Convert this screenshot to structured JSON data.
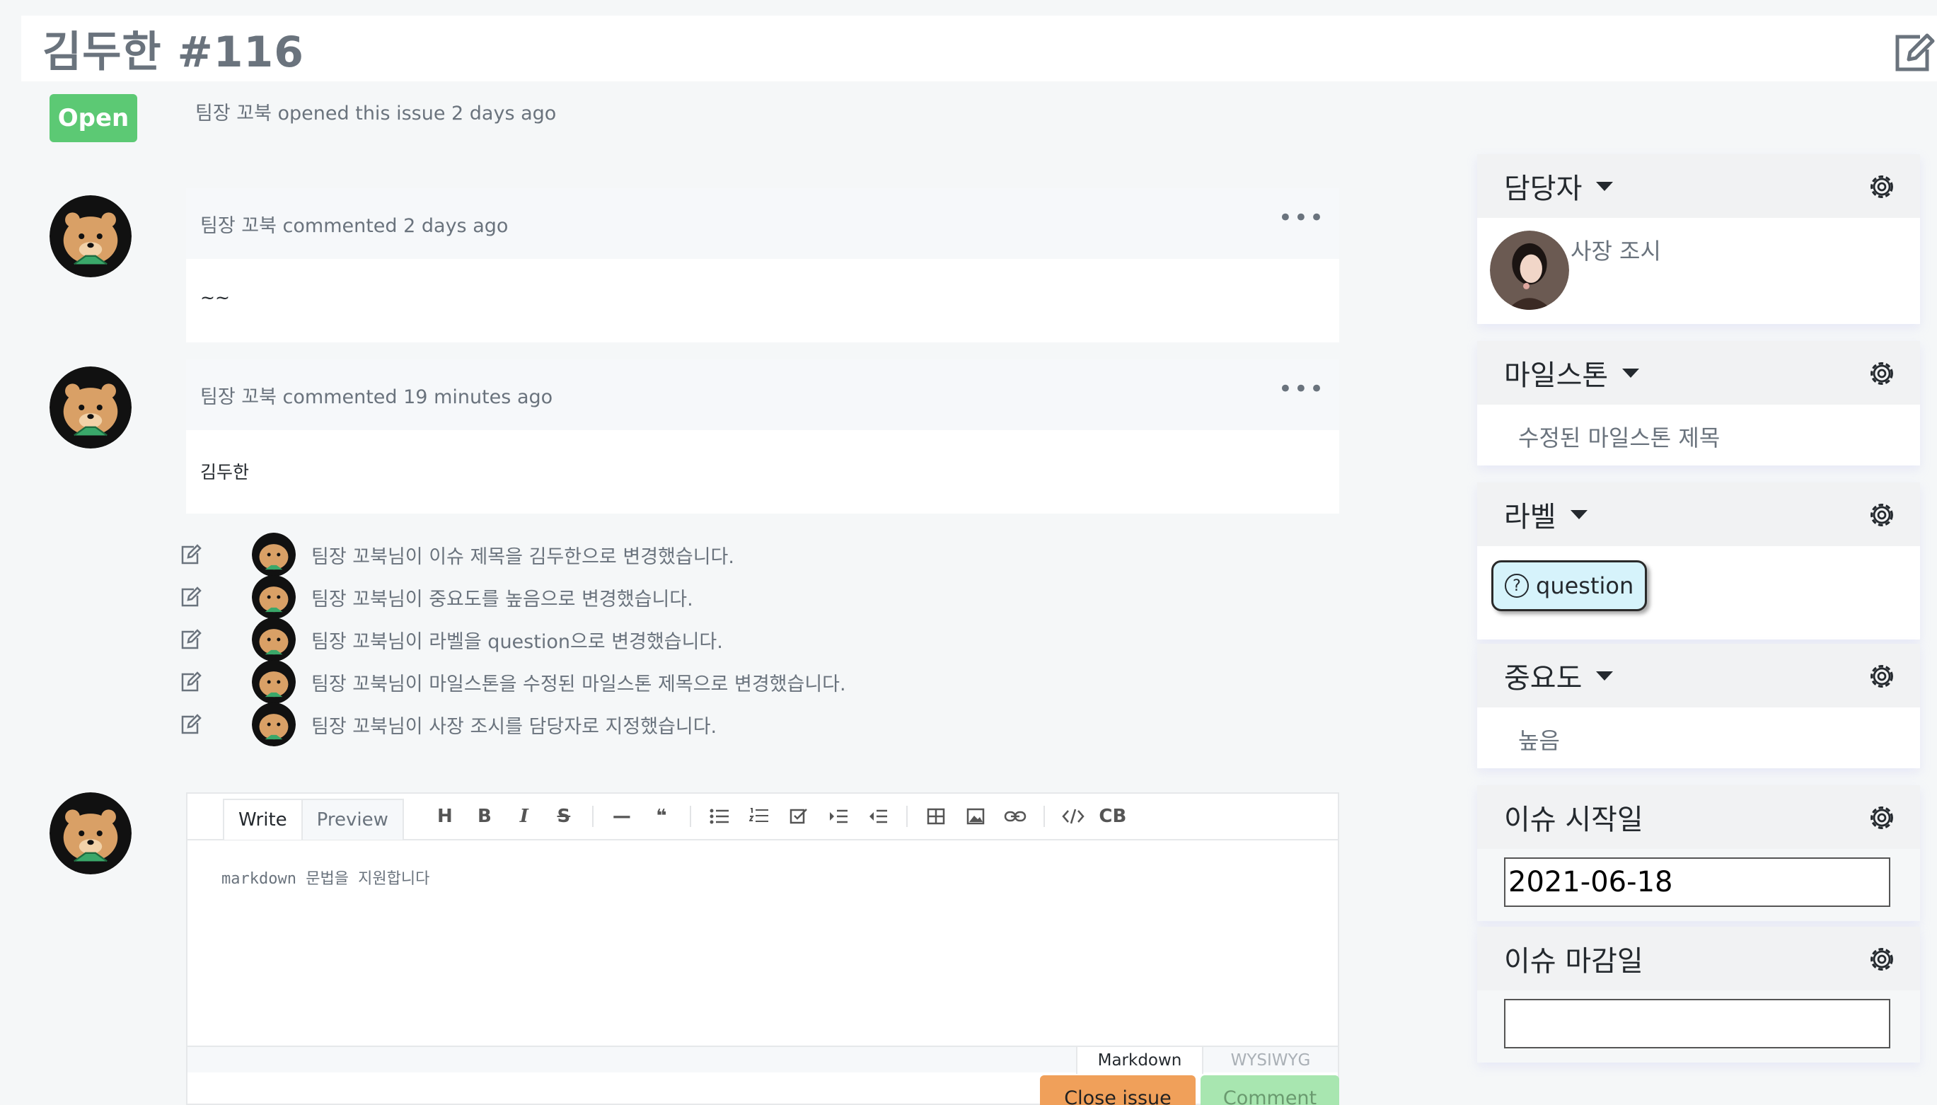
{
  "issue": {
    "title": "김두한 #116",
    "status": "Open",
    "opened_meta": "팀장 꼬북 opened this issue 2 days ago"
  },
  "comments": [
    {
      "meta": "팀장 꼬북 commented 2 days ago",
      "menu": "•••",
      "body": "~~"
    },
    {
      "meta": "팀장 꼬북 commented 19 minutes ago",
      "menu": "•••",
      "body": "김두한"
    }
  ],
  "history": [
    "팀장 꼬북님이 이슈 제목을 김두한으로 변경했습니다.",
    "팀장 꼬북님이 중요도를 높음으로 변경했습니다.",
    "팀장 꼬북님이 라벨을 question으로 변경했습니다.",
    "팀장 꼬북님이 마일스톤을 수정된 마일스톤 제목으로 변경했습니다.",
    "팀장 꼬북님이 사장 조시를 담당자로 지정했습니다."
  ],
  "editor": {
    "tab_write": "Write",
    "tab_preview": "Preview",
    "tools": {
      "heading": "H",
      "bold": "B",
      "italic": "I",
      "strike": "S",
      "hr": "—",
      "quote": "❝",
      "codeblock": "CB"
    },
    "placeholder": "markdown 문법을 지원합니다",
    "mode_markdown": "Markdown",
    "mode_wysiwyg": "WYSIWYG",
    "close_button": "Close issue",
    "comment_button": "Comment"
  },
  "sidebar": {
    "assignee": {
      "title": "담당자",
      "name": "사장 조시"
    },
    "milestone": {
      "title": "마일스톤",
      "value": "수정된 마일스톤 제목"
    },
    "label": {
      "title": "라벨",
      "value": "question",
      "color": "#d6f3fb"
    },
    "priority": {
      "title": "중요도",
      "value": "높음"
    },
    "start_date": {
      "title": "이슈 시작일",
      "value": "2021-06-18"
    },
    "due_date": {
      "title": "이슈 마감일",
      "value": ""
    }
  },
  "colors": {
    "open_badge": "#5cc974",
    "close_button": "#f0a05a",
    "comment_button": "#a8e6b0"
  }
}
